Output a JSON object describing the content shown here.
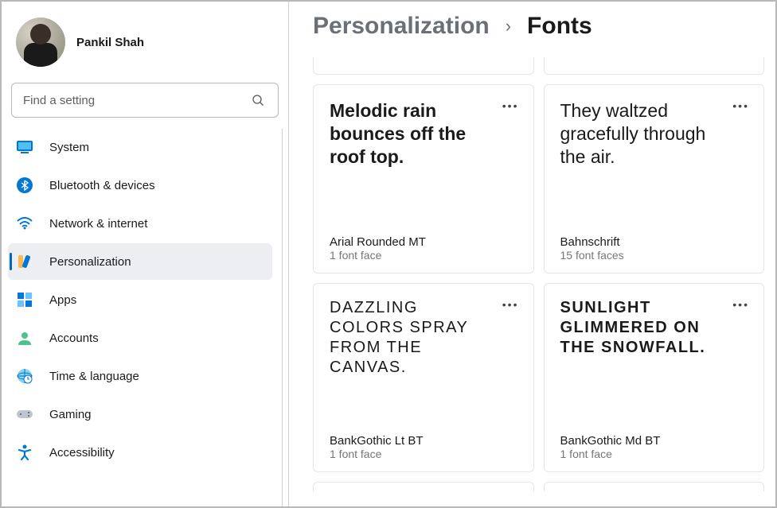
{
  "profile": {
    "name": "Pankil Shah"
  },
  "search": {
    "placeholder": "Find a setting"
  },
  "sidebar": {
    "items": [
      {
        "label": "System",
        "icon": "system-icon"
      },
      {
        "label": "Bluetooth & devices",
        "icon": "bluetooth-icon"
      },
      {
        "label": "Network & internet",
        "icon": "wifi-icon"
      },
      {
        "label": "Personalization",
        "icon": "personalization-icon",
        "active": true
      },
      {
        "label": "Apps",
        "icon": "apps-icon"
      },
      {
        "label": "Accounts",
        "icon": "accounts-icon"
      },
      {
        "label": "Time & language",
        "icon": "time-language-icon"
      },
      {
        "label": "Gaming",
        "icon": "gaming-icon"
      },
      {
        "label": "Accessibility",
        "icon": "accessibility-icon"
      }
    ]
  },
  "breadcrumb": {
    "parent": "Personalization",
    "current": "Fonts",
    "separator": "›"
  },
  "fonts": [
    {
      "preview": "Melodic rain bounces off the roof top.",
      "name": "Arial Rounded MT",
      "faces": "1 font face",
      "style_class": "preview-rounded"
    },
    {
      "preview": "They waltzed gracefully through the air.",
      "name": "Bahnschrift",
      "faces": "15 font faces",
      "style_class": "preview-bahn"
    },
    {
      "preview": "Dazzling colors spray from the canvas.",
      "name": "BankGothic Lt BT",
      "faces": "1 font face",
      "style_class": "preview-bankgothic"
    },
    {
      "preview": "Sunlight glimmered on the snowfall.",
      "name": "BankGothic Md BT",
      "faces": "1 font face",
      "style_class": "preview-bankgothic-md"
    }
  ]
}
